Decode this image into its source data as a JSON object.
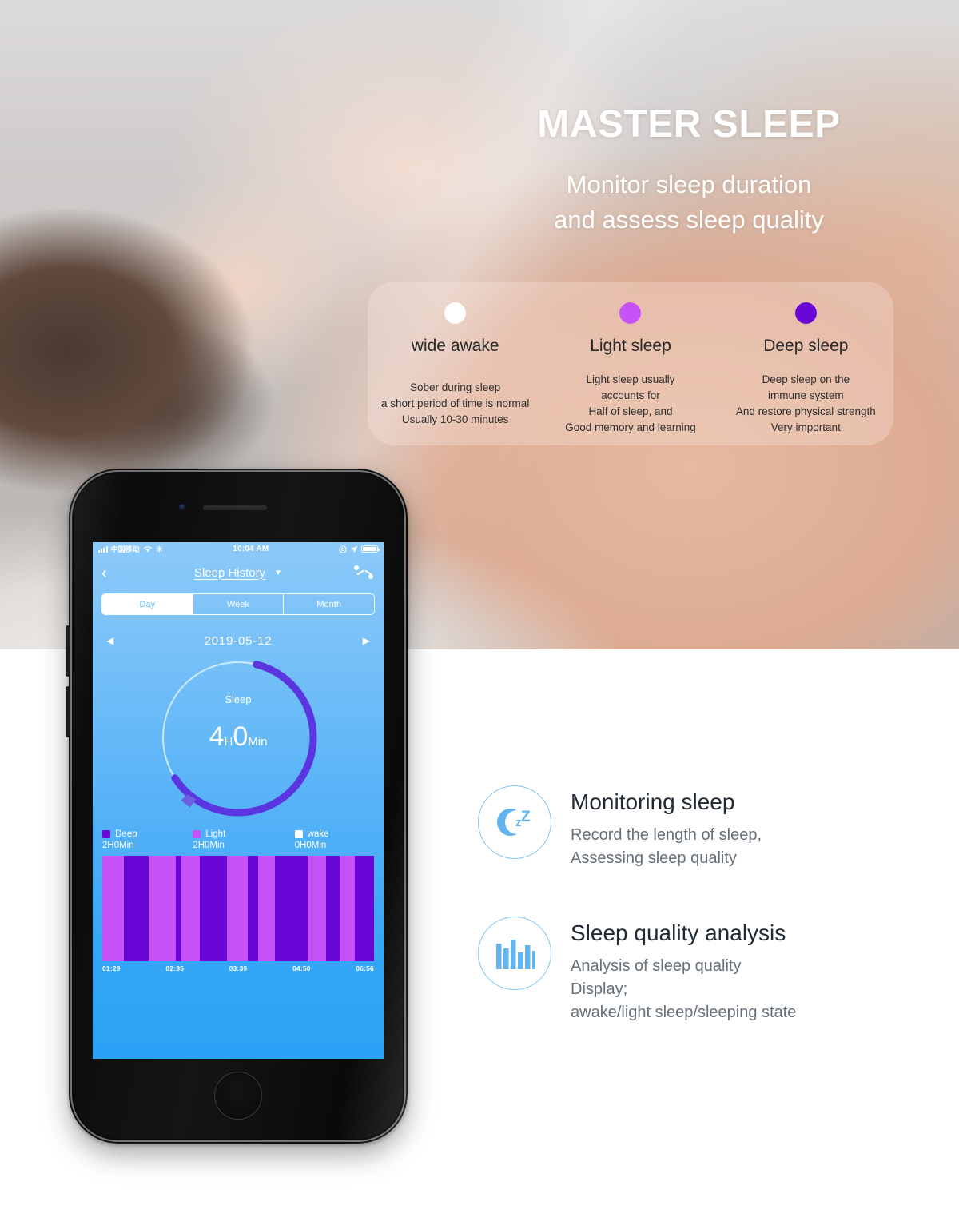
{
  "hero": {
    "headline": "MASTER SLEEP",
    "subhead": "Monitor sleep duration\nand assess sleep quality"
  },
  "legend_card": {
    "items": [
      {
        "name": "wide-awake",
        "label": "wide awake",
        "color": "#ffffff",
        "desc": "Sober during sleep\na short period of time is normal\nUsually 10-30 minutes"
      },
      {
        "name": "light-sleep",
        "label": "Light sleep",
        "color": "#c653f7",
        "desc": "Light sleep usually\naccounts for\nHalf of sleep, and\nGood memory and learning"
      },
      {
        "name": "deep-sleep",
        "label": "Deep sleep",
        "color": "#6a07d6",
        "desc": "Deep sleep on the\nimmune system\nAnd restore physical strength\nVery important"
      }
    ]
  },
  "phone": {
    "statusbar": {
      "carrier": "中国移动",
      "time": "10:04 AM",
      "wifi_icon": "wifi-icon",
      "signal_icon": "signal-bars-icon",
      "location_icon": "location-arrow-icon",
      "alarm_icon": "alarm-icon",
      "battery_icon": "battery-icon"
    },
    "navbar": {
      "back_icon": "chevron-left-icon",
      "title": "Sleep History",
      "caret_icon": "caret-down-icon",
      "share_icon": "share-nodes-icon"
    },
    "tabs": [
      {
        "label": "Day",
        "active": true
      },
      {
        "label": "Week",
        "active": false
      },
      {
        "label": "Month",
        "active": false
      }
    ],
    "date_nav": {
      "prev_icon": "triangle-left-icon",
      "date": "2019-05-12",
      "next_icon": "triangle-right-icon"
    },
    "ring": {
      "label": "Sleep",
      "hours": "4",
      "hours_unit": "H",
      "minutes": "0",
      "minutes_unit": "Min",
      "progress_percent": 62,
      "track_color": "#cfe9fb",
      "progress_color": "#5b35e0",
      "marker_icon": "sleep-pillow-icon"
    },
    "app_legend": [
      {
        "label": "Deep",
        "value": "2H0Min",
        "color": "#6a07d6"
      },
      {
        "label": "Light",
        "value": "2H0Min",
        "color": "#c653f7"
      },
      {
        "label": "wake",
        "value": "0H0Min",
        "color": "#ffffff"
      }
    ],
    "chart_data": {
      "type": "bar",
      "title": "Sleep stage timeline",
      "xlabel": "",
      "ylabel": "",
      "grid": false,
      "legend_position": "above-chart",
      "categories": [
        "01:29",
        "02:35",
        "03:39",
        "04:50",
        "06:56"
      ],
      "tick_labels": [
        "01:29",
        "02:35",
        "03:39",
        "04:50",
        "06:56"
      ],
      "segments": [
        {
          "state": "Light",
          "color": "#c653f7",
          "width_pct": 8.0
        },
        {
          "state": "Deep",
          "color": "#6a07d6",
          "width_pct": 9.0
        },
        {
          "state": "Light",
          "color": "#c653f7",
          "width_pct": 10.0
        },
        {
          "state": "Deep",
          "color": "#6a07d6",
          "width_pct": 2.0
        },
        {
          "state": "Light",
          "color": "#c653f7",
          "width_pct": 7.0
        },
        {
          "state": "Deep",
          "color": "#6a07d6",
          "width_pct": 10.0
        },
        {
          "state": "Light",
          "color": "#c653f7",
          "width_pct": 7.5
        },
        {
          "state": "Deep",
          "color": "#6a07d6",
          "width_pct": 4.0
        },
        {
          "state": "Light",
          "color": "#c653f7",
          "width_pct": 6.0
        },
        {
          "state": "Deep",
          "color": "#6a07d6",
          "width_pct": 12.0
        },
        {
          "state": "Light",
          "color": "#c653f7",
          "width_pct": 7.0
        },
        {
          "state": "Deep",
          "color": "#6a07d6",
          "width_pct": 5.0
        },
        {
          "state": "Light",
          "color": "#c653f7",
          "width_pct": 5.5
        },
        {
          "state": "Deep",
          "color": "#6a07d6",
          "width_pct": 7.0
        }
      ]
    }
  },
  "features": [
    {
      "icon": "moon-zzz-icon",
      "title": "Monitoring sleep",
      "desc": "Record the length of sleep,\nAssessing sleep quality"
    },
    {
      "icon": "bar-chart-icon",
      "title": "Sleep quality analysis",
      "desc": "Analysis of sleep quality\nDisplay;\nawake/light sleep/sleeping state"
    }
  ],
  "colors": {
    "accent_blue": "#5aaee8",
    "deep_sleep": "#6a07d6",
    "light_sleep": "#c653f7",
    "awake": "#ffffff",
    "ring_progress": "#5b35e0"
  }
}
